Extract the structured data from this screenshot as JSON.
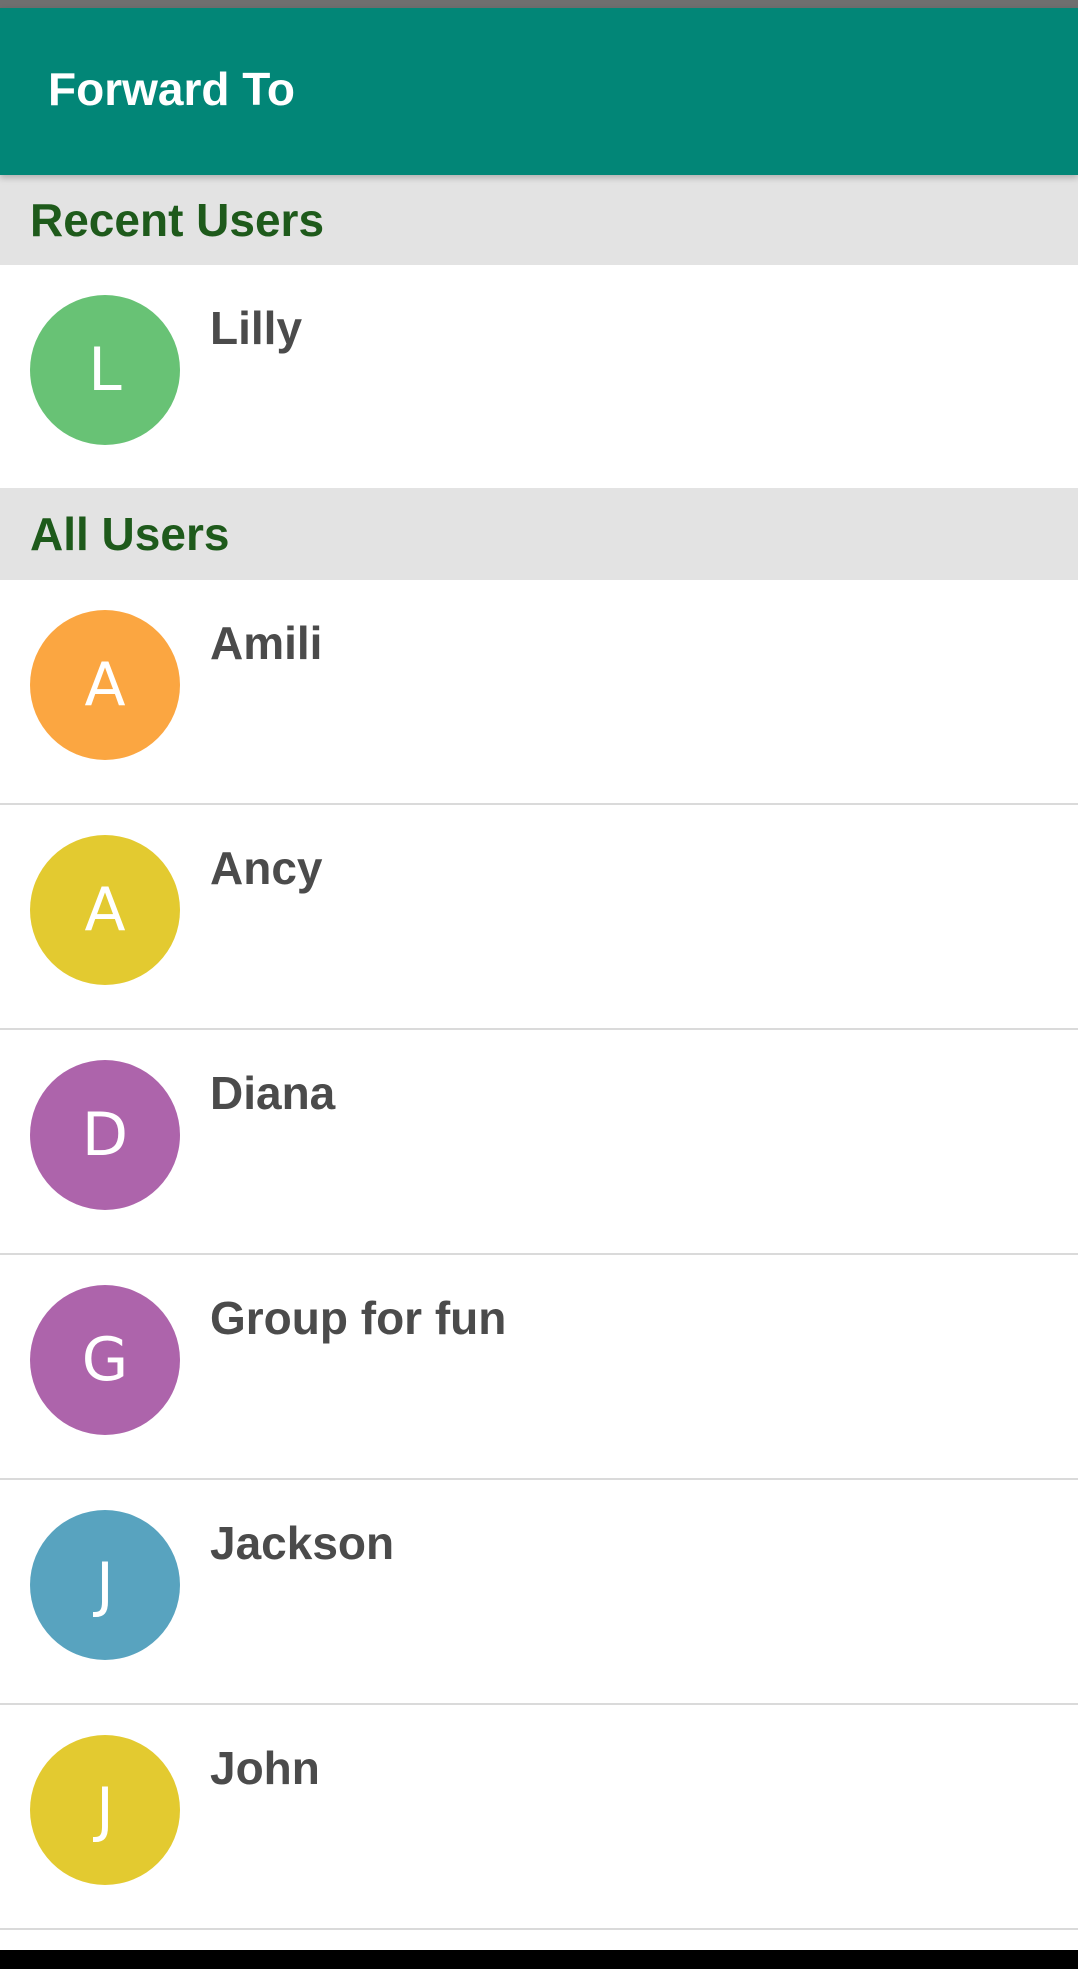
{
  "app_bar": {
    "title": "Forward To",
    "color": "#028677"
  },
  "sections": {
    "recent": {
      "title": "Recent Users",
      "users": [
        {
          "name": "Lilly",
          "initial": "L",
          "color": "#68c275"
        }
      ]
    },
    "all": {
      "title": "All Users",
      "users": [
        {
          "name": "Amili",
          "initial": "A",
          "color": "#fba641"
        },
        {
          "name": "Ancy",
          "initial": "A",
          "color": "#e3ca30"
        },
        {
          "name": "Diana",
          "initial": "D",
          "color": "#ad64ab"
        },
        {
          "name": "Group for fun",
          "initial": "G",
          "color": "#ad64ab"
        },
        {
          "name": "Jackson",
          "initial": "J",
          "color": "#58a3bf"
        },
        {
          "name": "John",
          "initial": "J",
          "color": "#e3ca30"
        }
      ]
    }
  },
  "colors": {
    "section_header_bg": "#e3e3e3",
    "section_title": "#1e5a1b",
    "name_text": "#4b4b4b"
  }
}
